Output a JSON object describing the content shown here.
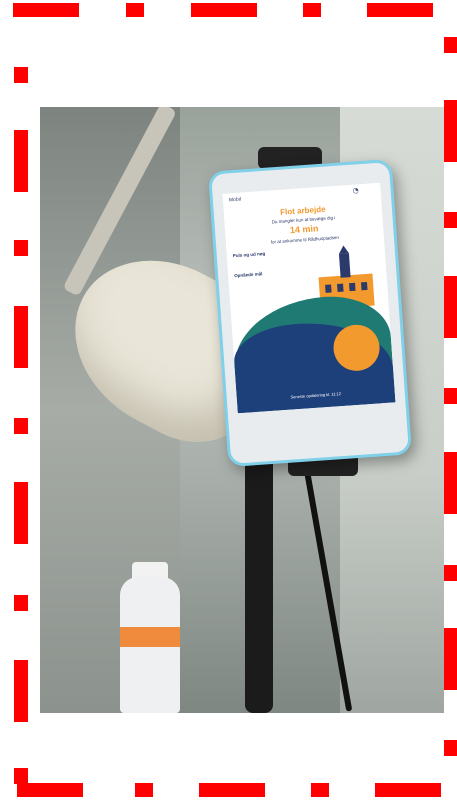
{
  "phone_screen": {
    "brand": "Mobil",
    "headline": "Flot arbejde",
    "subtitle": "Du mangler kun at bevæge dig i",
    "minutes": "14 min",
    "subtitle2": "for at ankomme til Rådhuspladsen",
    "section_one": "Puls og ud nøg",
    "section_two": "Opnåede mål",
    "footer": "Seneste opdatering kl. 11:12"
  },
  "colors": {
    "frame_dash": "#ff0000",
    "accent_orange": "#f29a2e",
    "navy": "#2b3a6b",
    "teal": "#1f7a73",
    "phone_bezel": "#7fd0e8"
  }
}
